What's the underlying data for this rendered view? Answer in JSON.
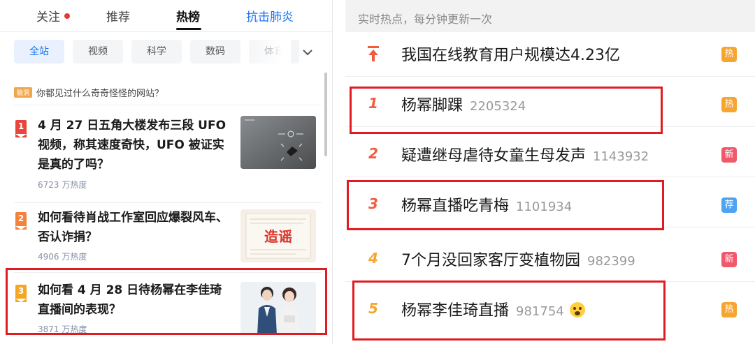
{
  "zhihu": {
    "tabs": [
      {
        "label": "关注",
        "has_dot": true
      },
      {
        "label": "推荐"
      },
      {
        "label": "热榜",
        "active": true
      },
      {
        "label": "抗击肺炎",
        "color": "#1772f6"
      }
    ],
    "chips": [
      "全站",
      "视频",
      "科学",
      "数码",
      "体育"
    ],
    "active_chip": "全站",
    "top_item": {
      "tag": "脑洞",
      "text": "你都见过什么奇奇怪怪的网站？"
    },
    "hot_items": [
      {
        "rank": "1",
        "title": "4 月 27 日五角大楼发布三段 UFO 视频，称其速度奇快，UFO 被证实是真的了吗？",
        "heat": "6723 万热度",
        "thumb": "ufo-image"
      },
      {
        "rank": "2",
        "title": "如何看待肖战工作室回应爆裂风车、否认诈捐？",
        "heat": "4906 万热度",
        "thumb": "rumor-image",
        "thumb_text": "造谣"
      },
      {
        "rank": "3",
        "title": "如何看 4 月 28 日待杨幂在李佳琦直播间的表现？",
        "heat": "3871 万热度",
        "thumb": "livestream-image"
      }
    ]
  },
  "weibo": {
    "header": "实时热点，每分钟更新一次",
    "rows": [
      {
        "rank": "",
        "pinned": true,
        "title": "我国在线教育用户规模达4.23亿",
        "count": "",
        "badge": "热",
        "badge_color": "#f7a531"
      },
      {
        "rank": "1",
        "title": "杨幂脚踝",
        "count": "2205324",
        "badge": "热",
        "badge_color": "#f7a531",
        "rank_color": "#f25b3e"
      },
      {
        "rank": "2",
        "title": "疑遭继母虐待女童生母发声",
        "count": "1143932",
        "badge": "新",
        "badge_color": "#f0586b",
        "rank_color": "#f25b3e"
      },
      {
        "rank": "3",
        "title": "杨幂直播吃青梅",
        "count": "1101934",
        "badge": "荐",
        "badge_color": "#4ea3f2",
        "rank_color": "#f25b3e"
      },
      {
        "rank": "4",
        "title": "7个月没回家客厅变植物园",
        "count": "982399",
        "badge": "新",
        "badge_color": "#f0586b",
        "rank_color": "#f7a531"
      },
      {
        "rank": "5",
        "title": "杨幂李佳琦直播",
        "count": "981754",
        "badge": "热",
        "badge_color": "#f7a531",
        "rank_color": "#f7a531",
        "emoji": "shocked-emoji"
      }
    ]
  },
  "colors": {
    "highlight_box": "#e01c22",
    "zhihu_blue": "#1772f6"
  }
}
